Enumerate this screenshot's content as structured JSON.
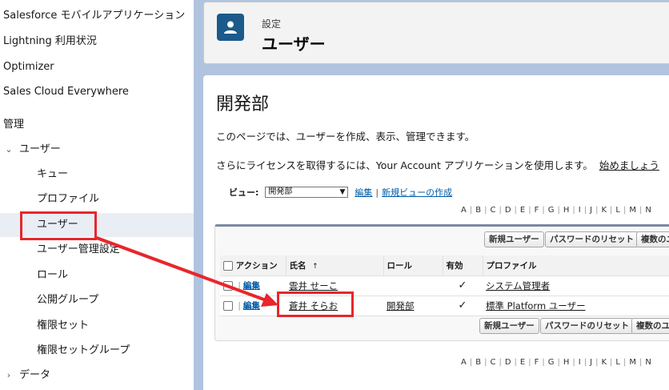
{
  "sidebar": {
    "items": [
      {
        "label": "Salesforce モバイルアプリケーション"
      },
      {
        "label": "Lightning 利用状況"
      },
      {
        "label": "Optimizer"
      },
      {
        "label": "Sales Cloud Everywhere"
      },
      {
        "label": "管理"
      },
      {
        "label": "ユーザー"
      },
      {
        "label": "キュー"
      },
      {
        "label": "プロファイル"
      },
      {
        "label": "ユーザー"
      },
      {
        "label": "ユーザー管理設定"
      },
      {
        "label": "ロール"
      },
      {
        "label": "公開グループ"
      },
      {
        "label": "権限セット"
      },
      {
        "label": "権限セットグループ"
      },
      {
        "label": "データ"
      }
    ]
  },
  "header": {
    "breadcrumb": "設定",
    "title": "ユーザー"
  },
  "main": {
    "title": "開発部",
    "description": "このページでは、ユーザーを作成、表示、管理できます。",
    "license_text": "さらにライセンスを取得するには、Your Account アプリケーションを使用します。",
    "license_link": "始めましょう",
    "view_label": "ビュー:",
    "view_value": "開発部",
    "edit_link": "編集",
    "sep": "|",
    "new_view_link": "新規ビューの作成",
    "alphabet": [
      "A",
      "B",
      "C",
      "D",
      "E",
      "F",
      "G",
      "H",
      "I",
      "J",
      "K",
      "L",
      "M",
      "N"
    ],
    "buttons_top": {
      "new_user": "新規ユーザー",
      "reset_password": "パスワードのリセット",
      "multi": "複数のユ"
    },
    "buttons_bottom": {
      "new_user": "新規ユーザー",
      "reset_password": "パスワードのリセット",
      "multi": "複数のユ"
    },
    "columns": {
      "action": "アクション",
      "name": "氏名",
      "sort_indicator": "↑",
      "role": "ロール",
      "active": "有効",
      "profile": "プロファイル"
    },
    "rows": [
      {
        "edit": "編集",
        "name": "雲井 せーこ",
        "role": "",
        "active": "✓",
        "profile": "システム管理者"
      },
      {
        "edit": "編集",
        "name": "蒼井 そらお",
        "role": "開発部",
        "active": "✓",
        "profile": "標準 Platform ユーザー"
      }
    ]
  },
  "annotation": {
    "color": "#e8262b"
  }
}
